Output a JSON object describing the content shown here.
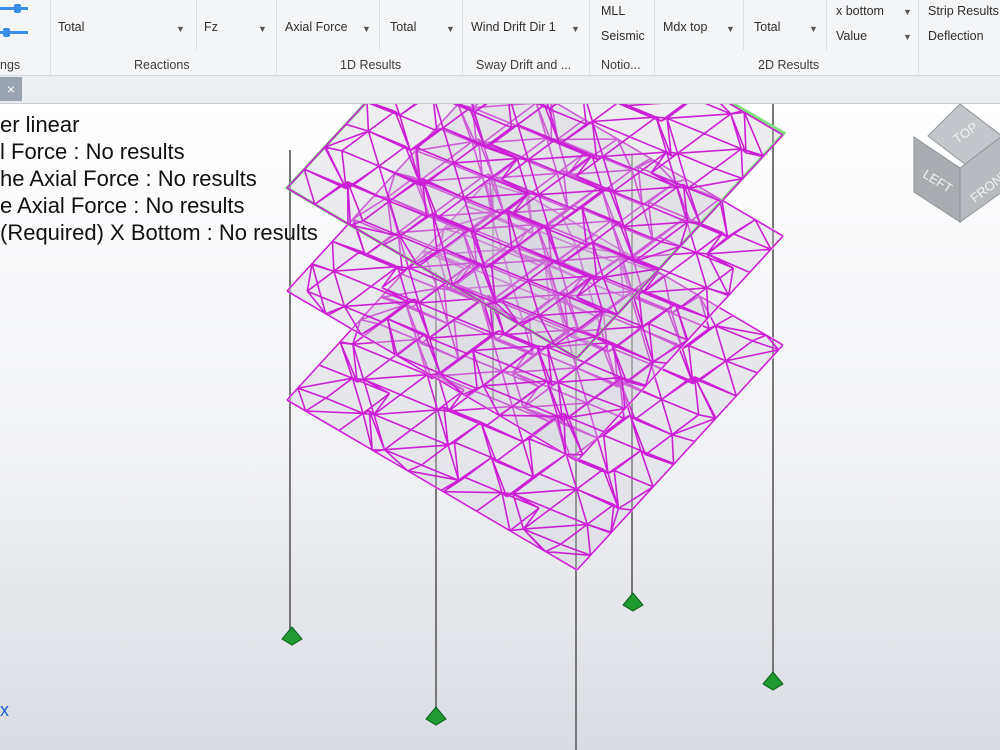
{
  "ribbon": {
    "groups": [
      {
        "label": "ngs"
      },
      {
        "label": "Reactions"
      },
      {
        "label": "1D Results"
      },
      {
        "label": "Sway Drift and ..."
      },
      {
        "label": "Notio..."
      },
      {
        "label": "2D Results"
      }
    ],
    "reactions_component": "Total",
    "reactions_direction": "Fz",
    "results1d_type": "Axial Force",
    "results1d_component": "Total",
    "sway_direction": "Wind Drift Dir 1",
    "notional_mll": "MLL",
    "notional_seismic": "Seismic",
    "results2d_type": "Mdx top",
    "results2d_component": "Total",
    "results2d_face": "x bottom",
    "results2d_mode": "Value",
    "strip_results": "Strip Results",
    "deflection": "Deflection"
  },
  "tab": {
    "close_glyph": "×"
  },
  "overlay": {
    "lines": [
      "er linear",
      "l Force : No results",
      "he Axial Force : No results",
      "e Axial Force : No results",
      "(Required) X Bottom : No results"
    ],
    "axis_glyph": "x"
  },
  "viewcube": {
    "top": "TOP",
    "left": "LEFT",
    "front": "FRONT"
  },
  "colors": {
    "mesh": "#cc1fd6",
    "selected_outline": "#7ee07a",
    "support": "#1f9a2f",
    "column": "#777777",
    "cube": "#b4b7bb"
  }
}
